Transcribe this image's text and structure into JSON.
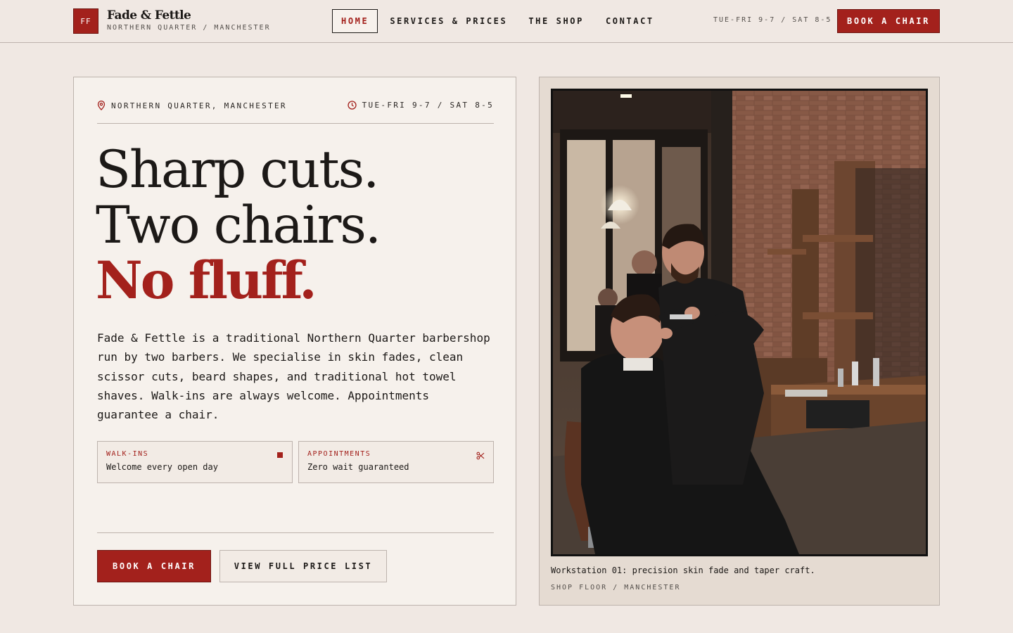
{
  "brand": {
    "logo_initials": "FF",
    "name": "Fade & Fettle",
    "subtitle": "NORTHERN QUARTER / MANCHESTER"
  },
  "nav": {
    "items": [
      {
        "label": "HOME",
        "active": true
      },
      {
        "label": "SERVICES & PRICES",
        "active": false
      },
      {
        "label": "THE SHOP",
        "active": false
      },
      {
        "label": "CONTACT",
        "active": false
      }
    ],
    "hours": "TUE-FRI 9-7 / SAT 8-5",
    "cta_label": "BOOK A CHAIR"
  },
  "hero": {
    "location": "NORTHERN QUARTER, MANCHESTER",
    "hours": "TUE-FRI 9-7 / SAT 8-5",
    "headline": {
      "line1": "Sharp cuts.",
      "line2": "Two chairs.",
      "line3": "No fluff."
    },
    "intro": "Fade & Fettle is a traditional Northern Quarter barbershop run by two barbers. We specialise in skin fades, clean scissor cuts, beard shapes, and traditional hot towel shaves. Walk-ins are always welcome. Appointments guarantee a chair.",
    "features": [
      {
        "title": "WALK-INS",
        "text": "Welcome every open day",
        "icon": "square-icon"
      },
      {
        "title": "APPOINTMENTS",
        "text": "Zero wait guaranteed",
        "icon": "scissors-icon"
      }
    ],
    "primary_button": "BOOK A CHAIR",
    "secondary_button": "VIEW FULL PRICE LIST"
  },
  "photo": {
    "caption": "Workstation 01: precision skin fade and taper craft.",
    "subcaption": "SHOP FLOOR / MANCHESTER"
  },
  "colors": {
    "accent": "#a3211c",
    "background": "#f0e8e3",
    "card": "#f6f1ec",
    "ink": "#1c1917"
  }
}
